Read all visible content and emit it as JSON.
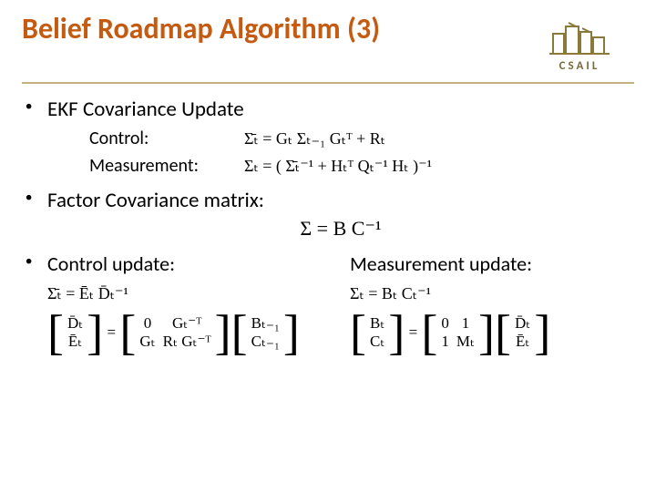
{
  "header": {
    "title": "Belief Roadmap Algorithm (3)",
    "logo_label": "CSAIL"
  },
  "bullets": {
    "b1": "EKF Covariance Update",
    "b2": "Factor Covariance matrix:",
    "b3": "Control update:"
  },
  "sub": {
    "control_label": "Control:",
    "measurement_label": "Measurement:"
  },
  "equations": {
    "ekf_control": "Σ̄ₜ = Gₜ Σₜ₋₁ Gₜᵀ + Rₜ",
    "ekf_measurement": "Σₜ = ( Σ̄ₜ⁻¹ + Hₜᵀ Qₜ⁻¹ Hₜ )⁻¹",
    "factor": "Σ = B C⁻¹",
    "ctrl_sigma": "Σ̄ₜ = Ēₜ D̄ₜ⁻¹",
    "meas_sigma": "Σₜ = Bₜ Cₜ⁻¹"
  },
  "col_headings": {
    "measurement": "Measurement update:"
  },
  "matrices": {
    "ctrl_left_top": "D̄ₜ",
    "ctrl_left_bot": "Ēₜ",
    "ctrl_mid_r1c1": "0",
    "ctrl_mid_r1c2": "Gₜ⁻ᵀ",
    "ctrl_mid_r2c1": "Gₜ",
    "ctrl_mid_r2c2": "Rₜ Gₜ⁻ᵀ",
    "ctrl_right_top": "Bₜ₋₁",
    "ctrl_right_bot": "Cₜ₋₁",
    "meas_left_top": "Bₜ",
    "meas_left_bot": "Cₜ",
    "meas_mid_r1c1": "0",
    "meas_mid_r1c2": "1",
    "meas_mid_r2c1": "1",
    "meas_mid_r2c2": "Mₜ",
    "meas_right_top": "D̄ₜ",
    "meas_right_bot": "Ēₜ"
  }
}
